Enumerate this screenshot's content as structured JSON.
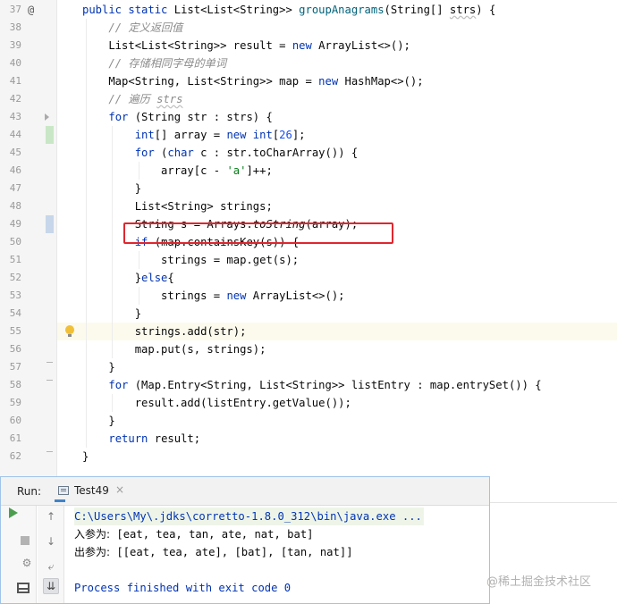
{
  "editor": {
    "lines": [
      {
        "num": "37",
        "html": "<span class=\"kw\">public</span> <span class=\"kw\">static</span> List&lt;List&lt;String&gt;&gt; <span class=\"fn\">groupAnagrams</span>(String[] <span class=\"uw\">strs</span>) {"
      },
      {
        "num": "38",
        "html": "    <span class=\"cm\">// 定义返回值</span>"
      },
      {
        "num": "39",
        "html": "    List&lt;List&lt;String&gt;&gt; result = <span class=\"kw\">new</span> ArrayList&lt;&gt;();"
      },
      {
        "num": "40",
        "html": "    <span class=\"cm\">// 存储相同字母的单词</span>"
      },
      {
        "num": "41",
        "html": "    Map&lt;String, List&lt;String&gt;&gt; map = <span class=\"kw\">new</span> HashMap&lt;&gt;();"
      },
      {
        "num": "42",
        "html": "    <span class=\"cm\">// 遍历 <span class=\"uw\">strs</span></span>"
      },
      {
        "num": "43",
        "html": "    <span class=\"kw\">for</span> (String str : strs) {"
      },
      {
        "num": "44",
        "html": "        <span class=\"kw\">int</span>[] array = <span class=\"kw\">new</span> <span class=\"kw\">int</span>[<span class=\"nm\">26</span>];"
      },
      {
        "num": "45",
        "html": "        <span class=\"kw\">for</span> (<span class=\"kw\">char</span> c : str.toCharArray()) {"
      },
      {
        "num": "46",
        "html": "            array[c - <span class=\"st\">'a'</span>]++;"
      },
      {
        "num": "47",
        "html": "        }"
      },
      {
        "num": "48",
        "html": "        List&lt;String&gt; strings;"
      },
      {
        "num": "49",
        "html": "        String s = Arrays.<span class=\"it\">toString</span>(array);"
      },
      {
        "num": "50",
        "html": "        <span class=\"kw\">if</span> (map.containsKey(s)) {"
      },
      {
        "num": "51",
        "html": "            strings = map.get(s);"
      },
      {
        "num": "52",
        "html": "        }<span class=\"kw\">else</span>{"
      },
      {
        "num": "53",
        "html": "            strings = <span class=\"kw\">new</span> ArrayList&lt;&gt;();"
      },
      {
        "num": "54",
        "html": "        }"
      },
      {
        "num": "55",
        "html": "        strings.add(str);"
      },
      {
        "num": "56",
        "html": "        map.put(s, strings);"
      },
      {
        "num": "57",
        "html": "    }"
      },
      {
        "num": "58",
        "html": "    <span class=\"kw\">for</span> (Map.Entry&lt;String, List&lt;String&gt;&gt; listEntry : map.entrySet()) {"
      },
      {
        "num": "59",
        "html": "        result.add(listEntry.getValue());"
      },
      {
        "num": "60",
        "html": "    }"
      },
      {
        "num": "61",
        "html": "    <span class=\"kw\">return</span> result;"
      },
      {
        "num": "62",
        "html": "}"
      }
    ],
    "override_marker": "@"
  },
  "run_panel": {
    "label": "Run:",
    "tab_name": "Test49",
    "tab_close": "×",
    "console": {
      "command": "C:\\Users\\My\\.jdks\\corretto-1.8.0_312\\bin\\java.exe ...",
      "input_label": "入参为:",
      "input_value": " [eat, tea, tan, ate, nat, bat]",
      "output_label": "出参为:",
      "output_value": " [[eat, tea, ate], [bat], [tan, nat]]",
      "finish": "Process finished with exit code 0"
    }
  },
  "icons": {
    "up": "↑",
    "down": "↓",
    "wrap": "⤶",
    "scroll_end": "⇊",
    "screenshot": "⚙"
  },
  "watermark": "@稀土掘金技术社区"
}
